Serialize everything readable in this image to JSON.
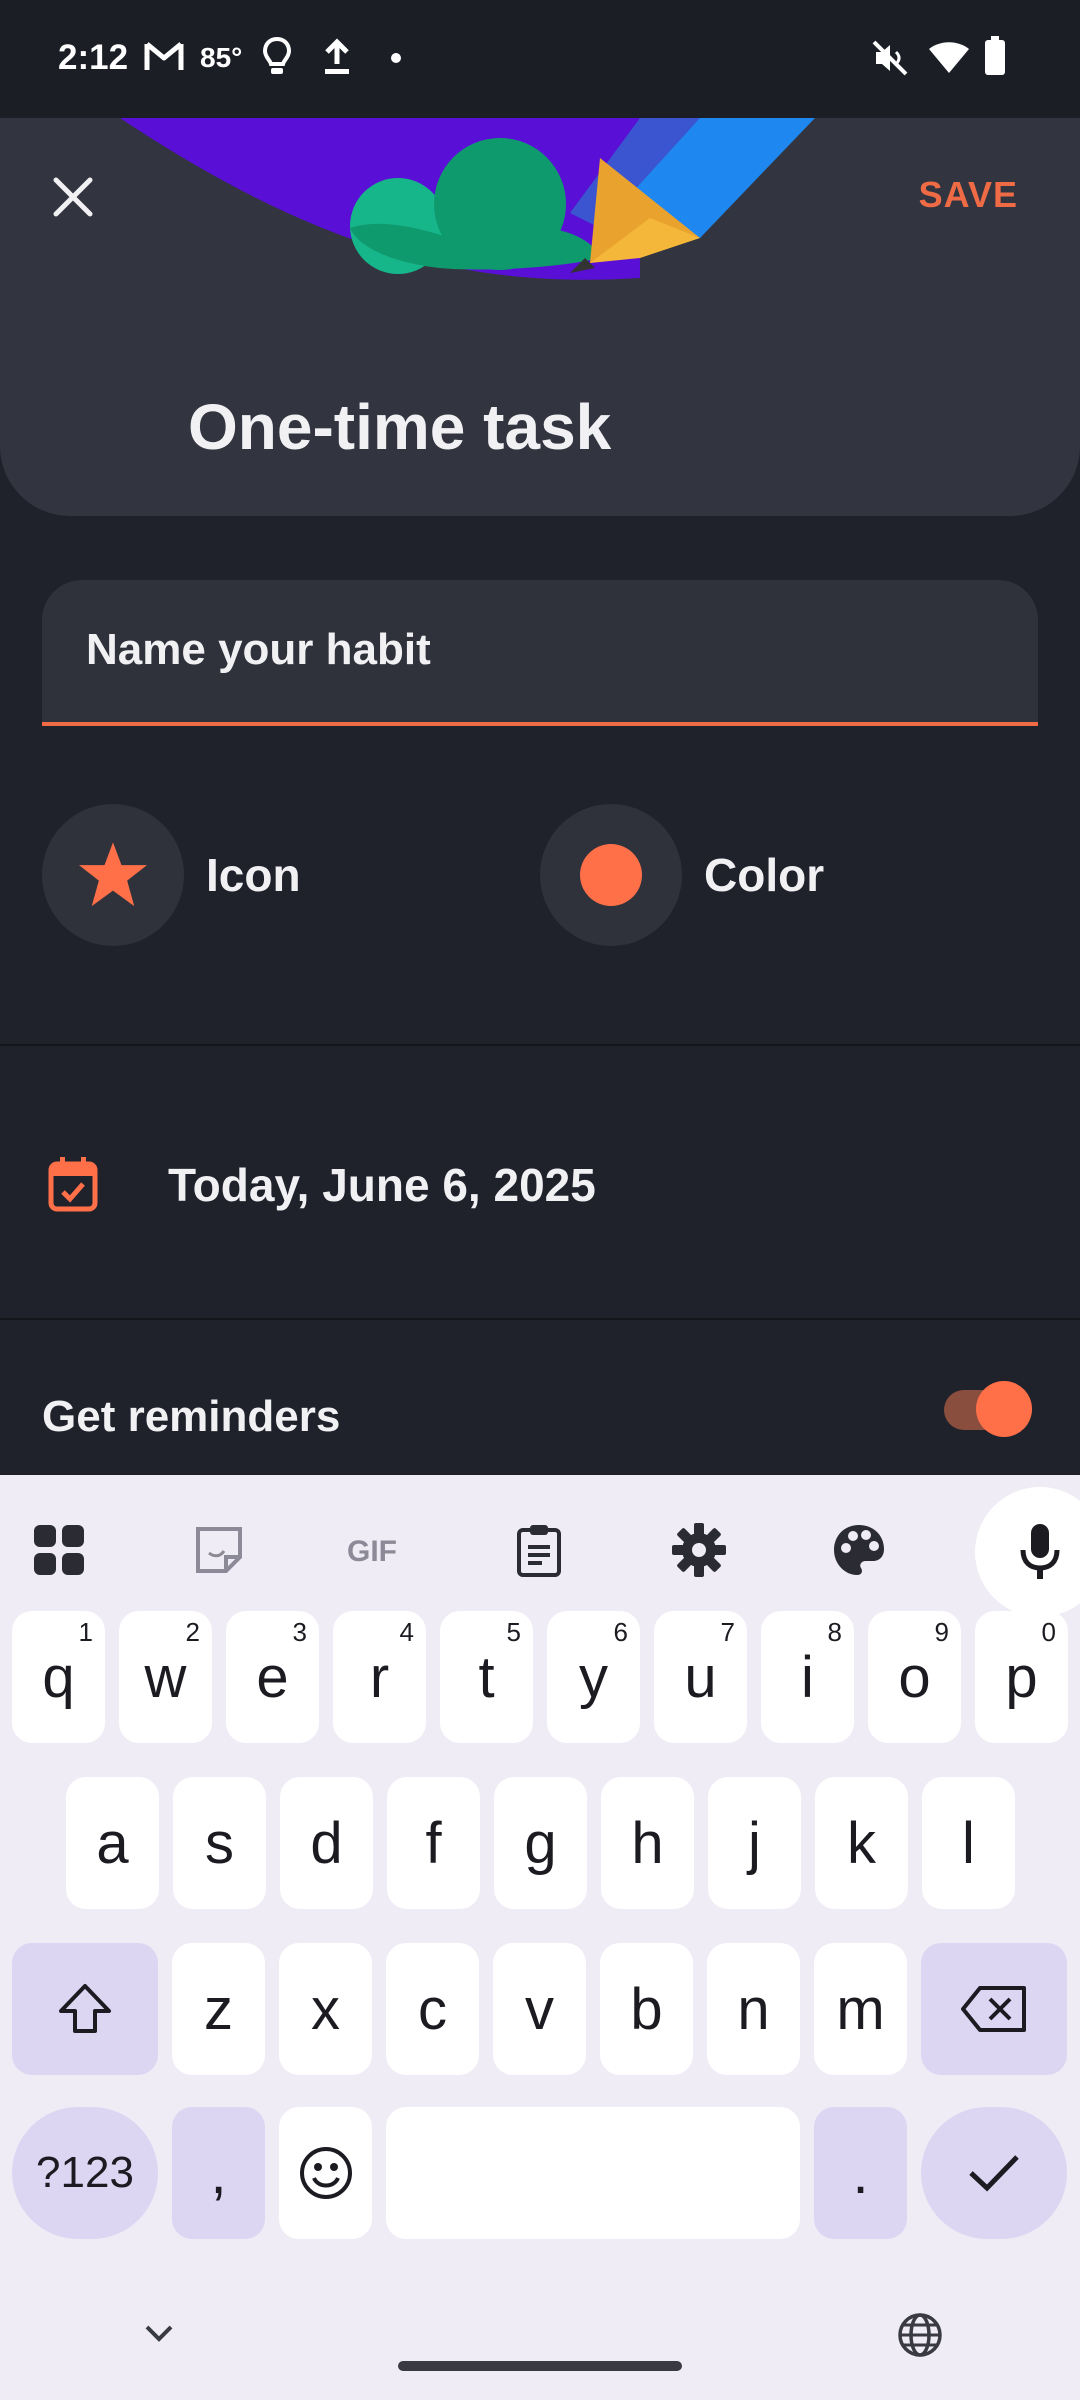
{
  "status_bar": {
    "time": "2:12",
    "temperature": "85°",
    "icons": [
      "gmail-icon",
      "lightbulb-icon",
      "upload-icon",
      "dot-icon",
      "mute-icon",
      "wifi-icon",
      "battery-icon"
    ]
  },
  "header": {
    "title": "One-time task",
    "save_label": "SAVE",
    "close_icon": "close-icon"
  },
  "name_field": {
    "placeholder": "Name your habit",
    "value": ""
  },
  "options": {
    "icon_label": "Icon",
    "color_label": "Color",
    "accent_color": "#ff7049"
  },
  "date": {
    "text": "Today, June 6, 2025"
  },
  "reminders": {
    "label": "Get reminders",
    "enabled": true
  },
  "keyboard": {
    "row1": [
      {
        "key": "q",
        "hint": "1"
      },
      {
        "key": "w",
        "hint": "2"
      },
      {
        "key": "e",
        "hint": "3"
      },
      {
        "key": "r",
        "hint": "4"
      },
      {
        "key": "t",
        "hint": "5"
      },
      {
        "key": "y",
        "hint": "6"
      },
      {
        "key": "u",
        "hint": "7"
      },
      {
        "key": "i",
        "hint": "8"
      },
      {
        "key": "o",
        "hint": "9"
      },
      {
        "key": "p",
        "hint": "0"
      }
    ],
    "row2": [
      "a",
      "s",
      "d",
      "f",
      "g",
      "h",
      "j",
      "k",
      "l"
    ],
    "row3": [
      "z",
      "x",
      "c",
      "v",
      "b",
      "n",
      "m"
    ],
    "symbols_label": "?123",
    "comma": ",",
    "period": "."
  }
}
